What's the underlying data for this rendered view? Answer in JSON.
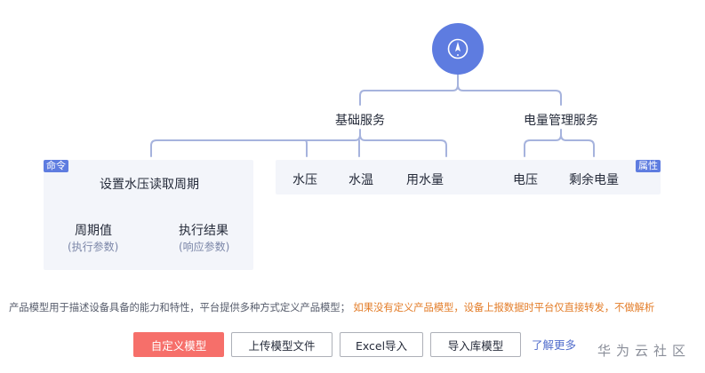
{
  "model": {
    "device_icon": "compass-icon",
    "services": [
      {
        "name": "基础服务",
        "commands": [
          {
            "tag": "命令",
            "name": "设置水压读取周期",
            "params": [
              {
                "label": "周期值",
                "sub": "(执行参数)"
              },
              {
                "label": "执行结果",
                "sub": "(响应参数)"
              }
            ]
          }
        ],
        "properties": [
          "水压",
          "水温",
          "用水量"
        ]
      },
      {
        "name": "电量管理服务",
        "properties_tag": "属性",
        "properties": [
          "电压",
          "剩余电量"
        ]
      }
    ]
  },
  "description": {
    "text": "产品模型用于描述设备具备的能力和特性，平台提供多种方式定义产品模型；",
    "warning": "如果没有定义产品模型，设备上报数据时平台仅直接转发，不做解析"
  },
  "actions": {
    "custom": "自定义模型",
    "upload": "上传模型文件",
    "excel": "Excel导入",
    "library": "导入库模型",
    "learn_more": "了解更多"
  },
  "watermark": "华为云社区",
  "colors": {
    "accent": "#5e7ce0",
    "line": "#a6b3dd",
    "panel": "#f3f5fa",
    "primary_button": "#f66f6a",
    "warning": "#e37d29",
    "link": "#526ecc"
  }
}
